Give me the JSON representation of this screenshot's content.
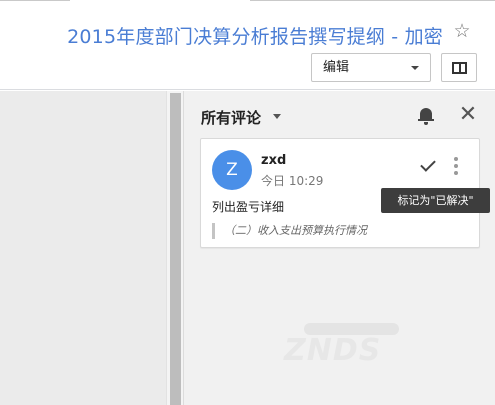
{
  "header": {
    "doc_title": "2015年度部门决算分析报告撰写提纲 - 加密",
    "star_icon": "star-outline-icon",
    "mode_select_value": "编辑",
    "panel_toggle_icon": "side-panel-icon"
  },
  "comments_panel": {
    "title": "所有评论",
    "bell_icon": "notification-bell-icon",
    "close_icon": "close-icon",
    "comment": {
      "avatar_letter": "Z",
      "avatar_color": "#4a8fe8",
      "author": "zxd",
      "time": "今日 10:29",
      "text": "列出盈亏详细",
      "quoted": "（二）收入支出预算执行情况",
      "resolve_icon": "checkmark-icon",
      "more_icon": "more-vertical-icon"
    },
    "tooltip": "标记为\"已解决\""
  },
  "watermark": "ZNDS",
  "colors": {
    "title_blue": "#4a7dd4",
    "sidebar_bg": "#f1f1f1",
    "tooltip_bg": "#3d3d3d"
  }
}
